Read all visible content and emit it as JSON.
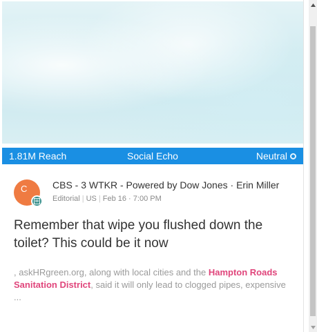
{
  "card": {
    "metrics": {
      "reach": "1.81M Reach",
      "source_type": "Social Echo",
      "sentiment": "Neutral"
    },
    "author": {
      "avatar_letter": "C",
      "source_name": "CBS - 3 WTKR - Powered by Dow Jones · Erin Miller",
      "category": "Editorial",
      "country": "US",
      "date": "Feb 16 · 7:00 PM"
    },
    "headline": "Remember that wipe you flushed down the toilet? This could be it now",
    "snippet": {
      "before": ", askHRgreen.org, along with local cities and the ",
      "highlight": "Hampton Roads Sanitation District",
      "after": ", said it will only lead to clogged pipes, expensive ..."
    }
  },
  "colors": {
    "metric_bar": "#1a8fe3",
    "avatar": "#ef7b42",
    "badge": "#2f8b87",
    "highlight": "#e0457b"
  },
  "icons": {
    "sentiment": "neutral-ring-icon",
    "badge": "editorial-badge-icon",
    "scroll_up": "scroll-up-arrow-icon",
    "scroll_down": "scroll-down-arrow-icon"
  }
}
